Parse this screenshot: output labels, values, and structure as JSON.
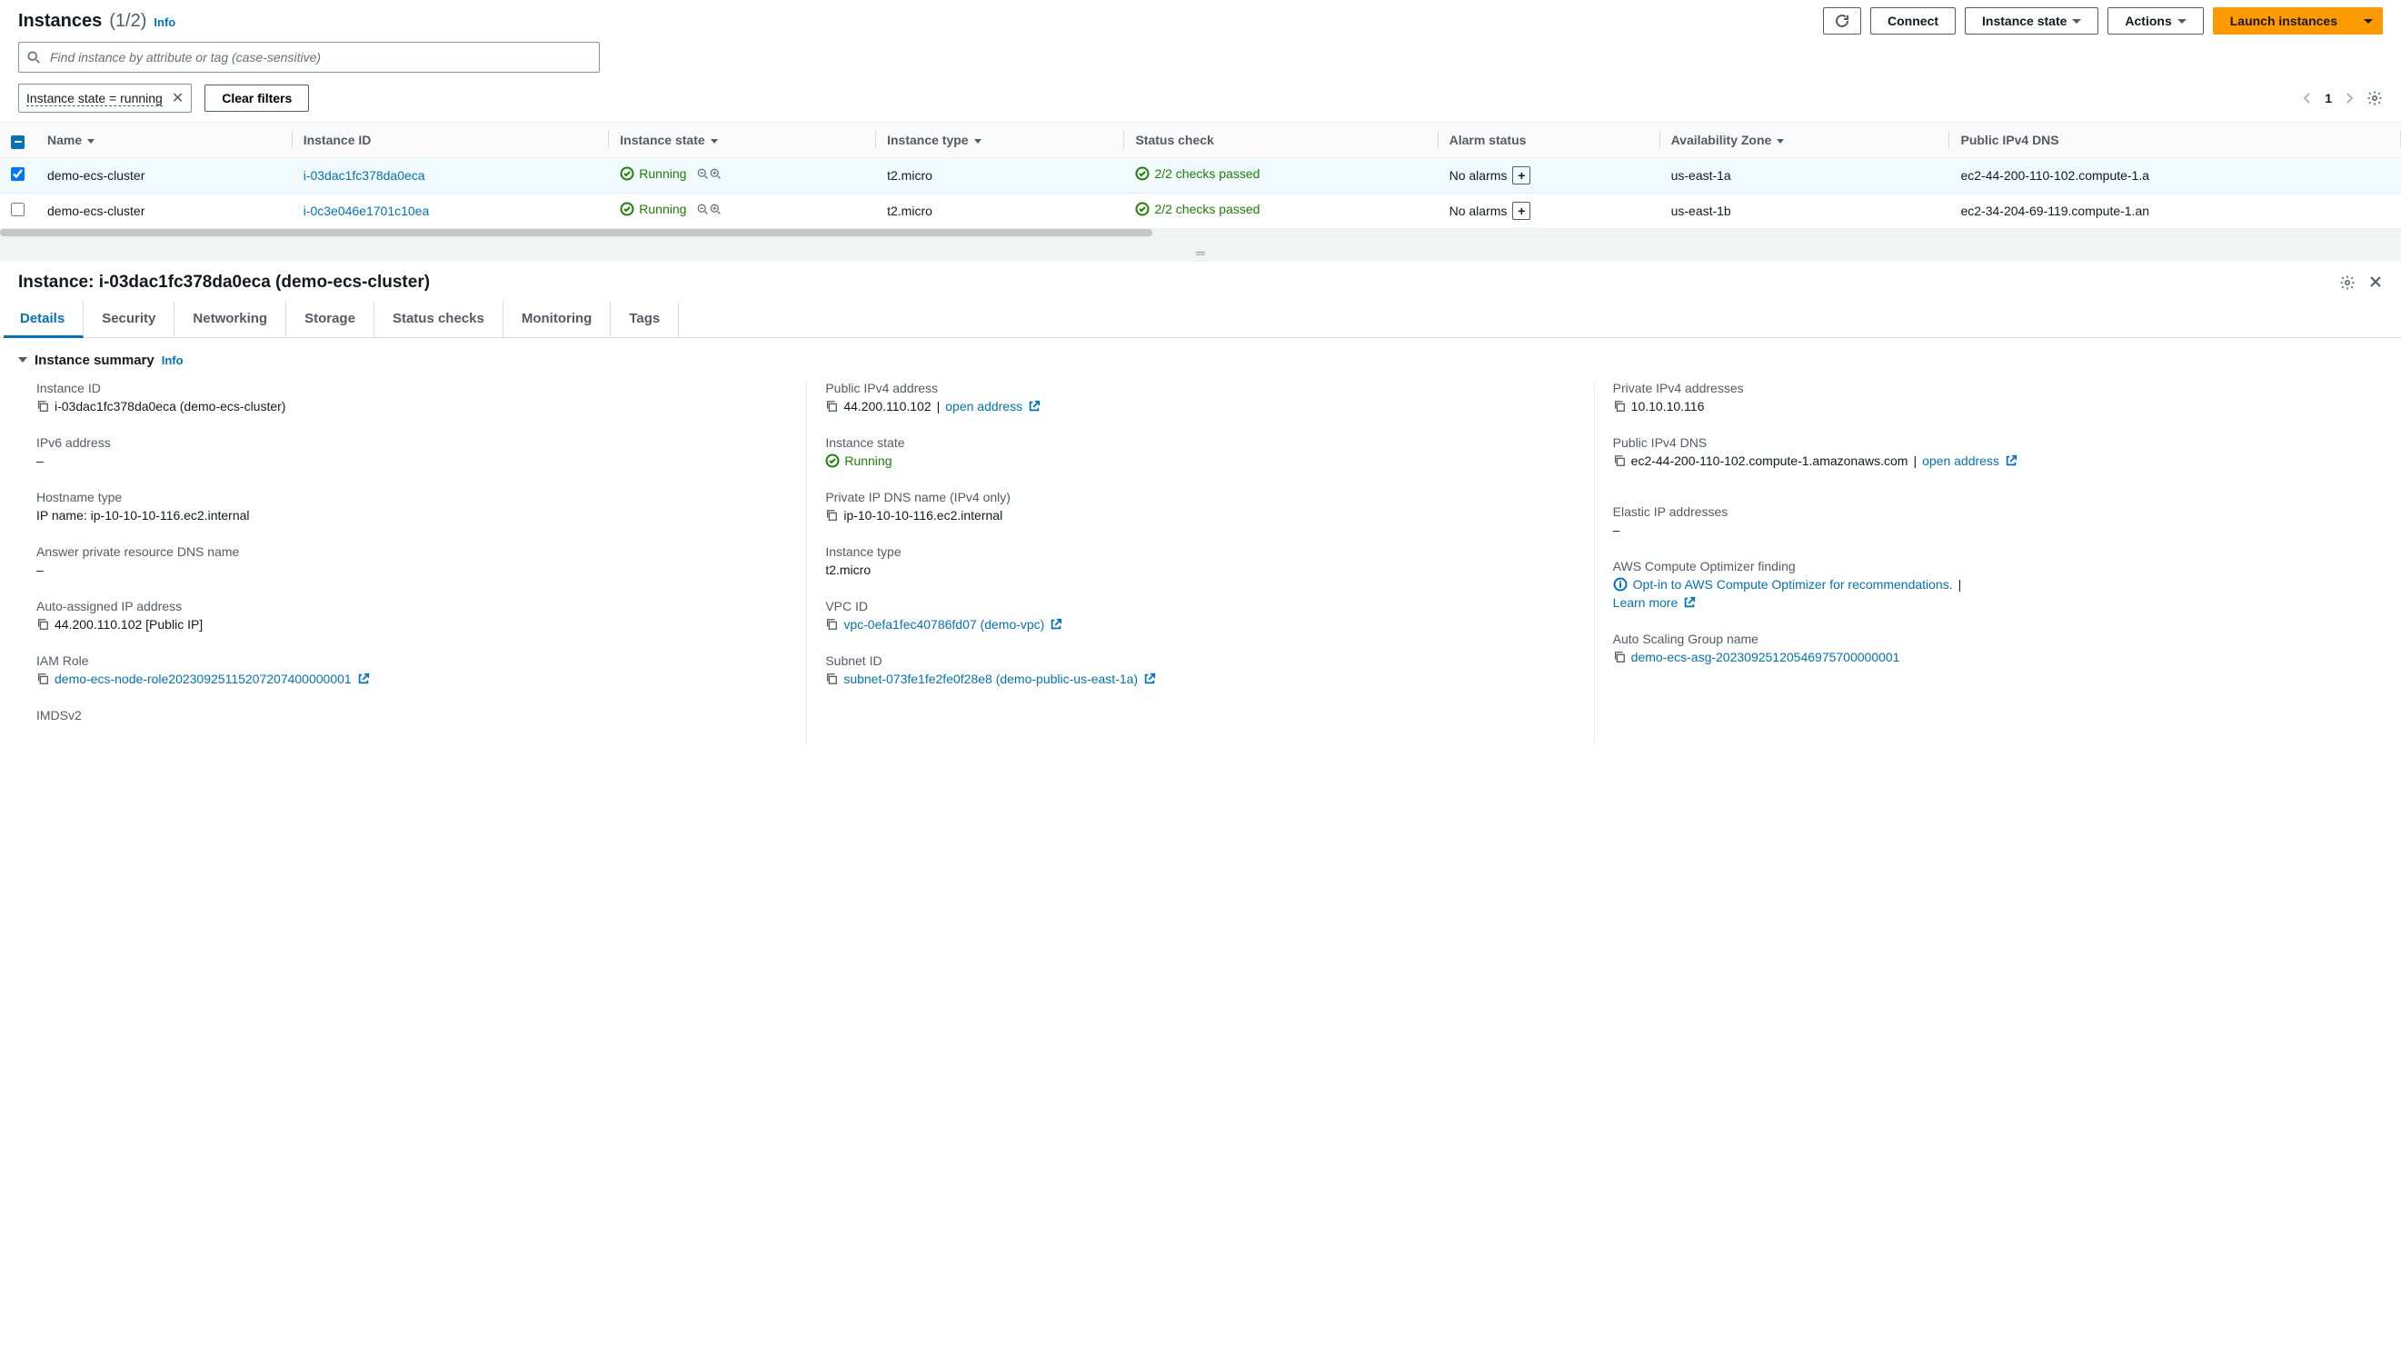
{
  "header": {
    "title": "Instances",
    "count": "(1/2)",
    "info": "Info",
    "connect": "Connect",
    "instance_state": "Instance state",
    "actions": "Actions",
    "launch": "Launch instances"
  },
  "search": {
    "placeholder": "Find instance by attribute or tag (case-sensitive)"
  },
  "filter": {
    "chip": "Instance state = running",
    "clear": "Clear filters",
    "page": "1"
  },
  "table": {
    "headers": {
      "name": "Name",
      "id": "Instance ID",
      "state": "Instance state",
      "type": "Instance type",
      "status": "Status check",
      "alarm": "Alarm status",
      "az": "Availability Zone",
      "dns": "Public IPv4 DNS"
    },
    "rows": [
      {
        "selected": true,
        "name": "demo-ecs-cluster",
        "id": "i-03dac1fc378da0eca",
        "state": "Running",
        "type": "t2.micro",
        "status": "2/2 checks passed",
        "alarm": "No alarms",
        "az": "us-east-1a",
        "dns": "ec2-44-200-110-102.compute-1.a"
      },
      {
        "selected": false,
        "name": "demo-ecs-cluster",
        "id": "i-0c3e046e1701c10ea",
        "state": "Running",
        "type": "t2.micro",
        "status": "2/2 checks passed",
        "alarm": "No alarms",
        "az": "us-east-1b",
        "dns": "ec2-34-204-69-119.compute-1.an"
      }
    ]
  },
  "detail": {
    "title": "Instance: i-03dac1fc378da0eca (demo-ecs-cluster)",
    "tabs": {
      "details": "Details",
      "security": "Security",
      "networking": "Networking",
      "storage": "Storage",
      "status": "Status checks",
      "monitoring": "Monitoring",
      "tags": "Tags"
    },
    "section_title": "Instance summary",
    "section_info": "Info",
    "fields": {
      "instance_id_label": "Instance ID",
      "instance_id_value": "i-03dac1fc378da0eca (demo-ecs-cluster)",
      "ipv6_label": "IPv6 address",
      "ipv6_value": "–",
      "hostname_type_label": "Hostname type",
      "hostname_type_value": "IP name: ip-10-10-10-116.ec2.internal",
      "answer_dns_label": "Answer private resource DNS name",
      "answer_dns_value": "–",
      "auto_ip_label": "Auto-assigned IP address",
      "auto_ip_value": "44.200.110.102 [Public IP]",
      "iam_label": "IAM Role",
      "iam_value": "demo-ecs-node-role20230925115207207400000001",
      "imds_label": "IMDSv2",
      "public_ipv4_label": "Public IPv4 address",
      "public_ipv4_value": "44.200.110.102",
      "open_address": "open address",
      "instance_state_label": "Instance state",
      "instance_state_value": "Running",
      "private_dns_label": "Private IP DNS name (IPv4 only)",
      "private_dns_value": "ip-10-10-10-116.ec2.internal",
      "instance_type_label": "Instance type",
      "instance_type_value": "t2.micro",
      "vpc_label": "VPC ID",
      "vpc_value": "vpc-0efa1fec40786fd07 (demo-vpc)",
      "subnet_label": "Subnet ID",
      "subnet_value": "subnet-073fe1fe2fe0f28e8 (demo-public-us-east-1a)",
      "private_ipv4_label": "Private IPv4 addresses",
      "private_ipv4_value": "10.10.10.116",
      "public_dns_label": "Public IPv4 DNS",
      "public_dns_value": "ec2-44-200-110-102.compute-1.amazonaws.com",
      "eip_label": "Elastic IP addresses",
      "eip_value": "–",
      "optimizer_label": "AWS Compute Optimizer finding",
      "optimizer_value": "Opt-in to AWS Compute Optimizer for recommendations.",
      "learn_more": "Learn more",
      "asg_label": "Auto Scaling Group name",
      "asg_value": "demo-ecs-asg-20230925120546975700000001"
    }
  }
}
